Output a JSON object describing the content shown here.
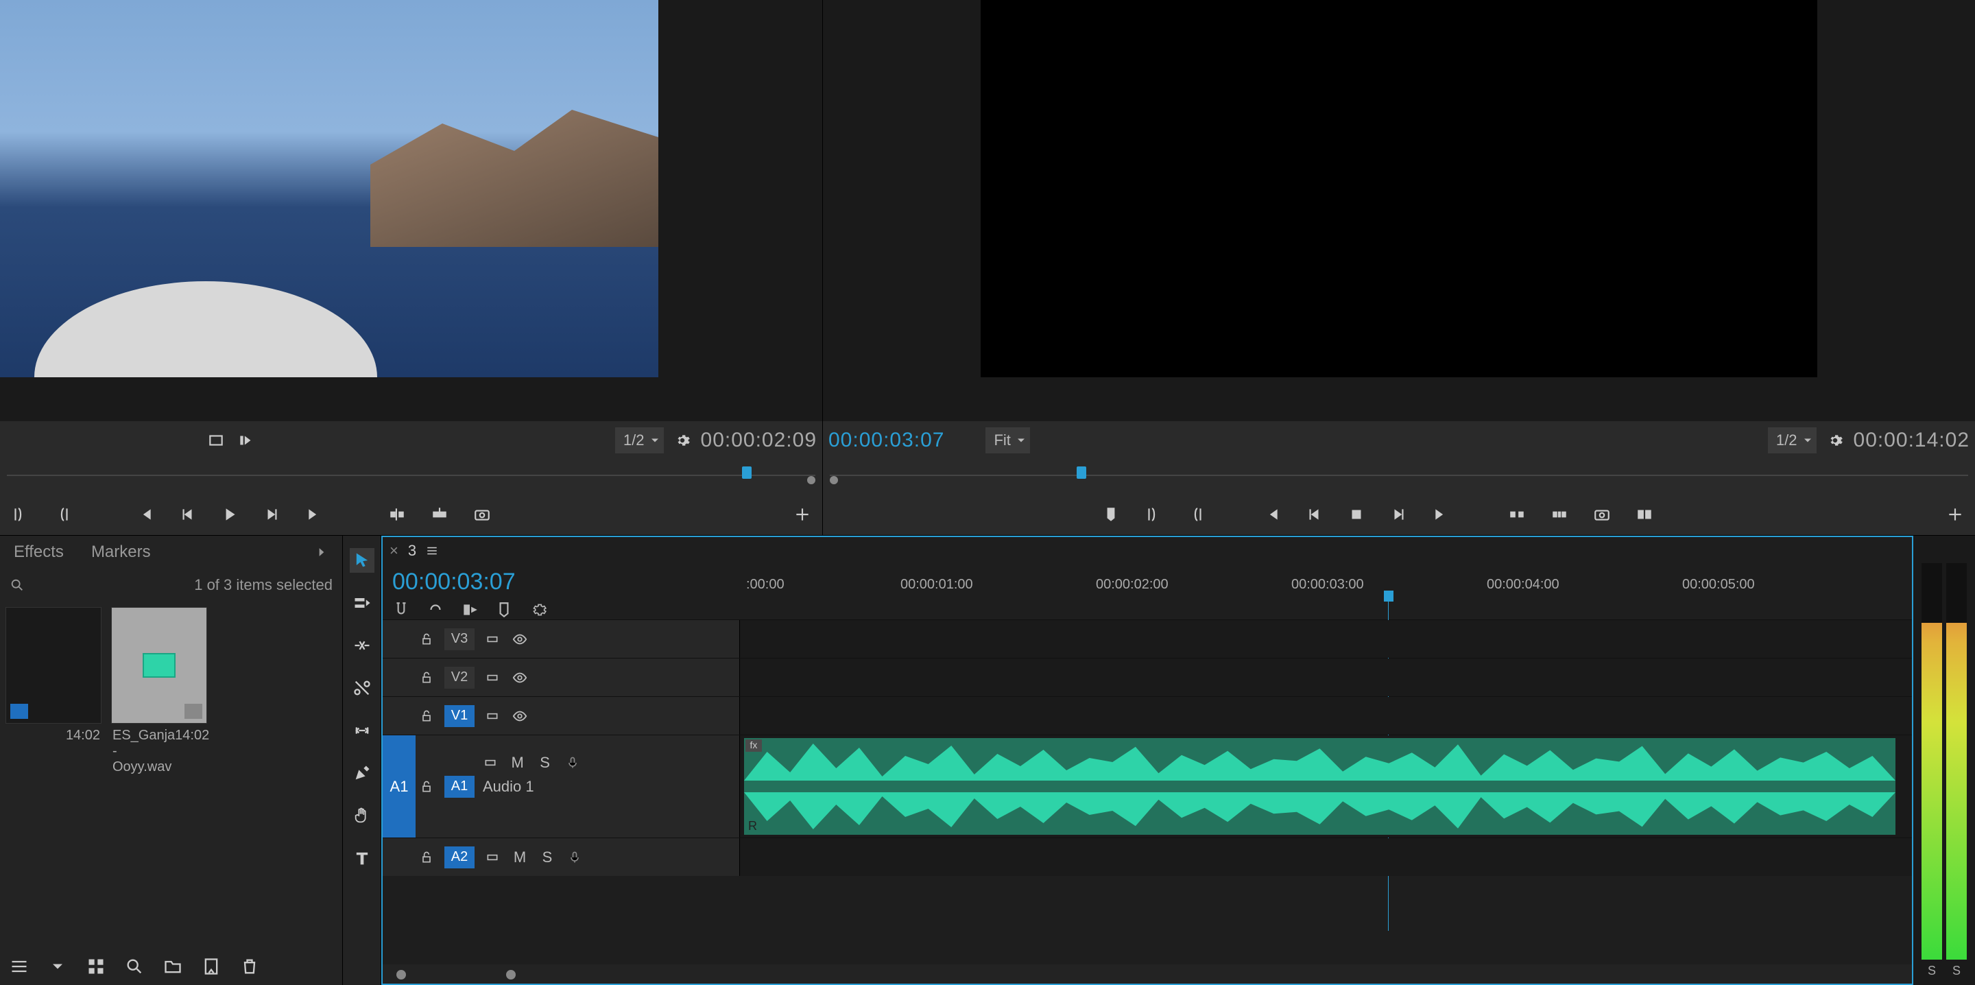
{
  "source": {
    "zoom": "1/2",
    "timecode": "00:00:02:09"
  },
  "program": {
    "timecode": "00:00:03:07",
    "fit": "Fit",
    "zoom": "1/2",
    "duration": "00:00:14:02"
  },
  "project": {
    "tabs": {
      "effects": "Effects",
      "markers": "Markers"
    },
    "selection": "1 of 3 items selected",
    "bins": [
      {
        "name": "",
        "dur": "14:02"
      },
      {
        "name": "ES_Ganja - Ooyy.wav",
        "dur": "14:02"
      }
    ]
  },
  "timeline": {
    "seq_name": "3",
    "timecode": "00:00:03:07",
    "ruler": [
      ":00:00",
      "00:00:01:00",
      "00:00:02:00",
      "00:00:03:00",
      "00:00:04:00",
      "00:00:05:00"
    ],
    "tracks": {
      "v3": "V3",
      "v2": "V2",
      "v1": "V1",
      "a1_patch": "A1",
      "a1": "A1",
      "a1_name": "Audio 1",
      "a2": "A2",
      "m": "M",
      "s": "S"
    },
    "clip": {
      "fx": "fx",
      "r": "R"
    }
  },
  "meters": {
    "s": "S"
  }
}
